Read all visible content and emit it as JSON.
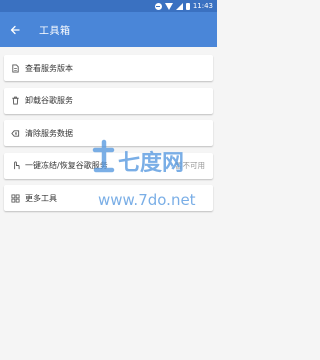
{
  "status_bar": {
    "time": "11:43"
  },
  "app_bar": {
    "title": "工具箱",
    "back_icon": "arrow-back-icon"
  },
  "colors": {
    "primary": "#4a86d8",
    "status_bar": "#3a71c1",
    "background": "#f5f5f5",
    "watermark": "#5a9be0"
  },
  "items": [
    {
      "label": "查看服务版本",
      "icon": "document-icon",
      "status": ""
    },
    {
      "label": "卸载谷歌服务",
      "icon": "trash-icon",
      "status": ""
    },
    {
      "label": "清除服务数据",
      "icon": "eraser-icon",
      "status": ""
    },
    {
      "label": "一键冻结/恢复谷歌服务",
      "icon": "hand-icon",
      "status": "暂不可用"
    },
    {
      "label": "更多工具",
      "icon": "grid-icon",
      "status": ""
    }
  ],
  "watermark": {
    "logo_text": "七度网",
    "url": "www.7do.net"
  }
}
